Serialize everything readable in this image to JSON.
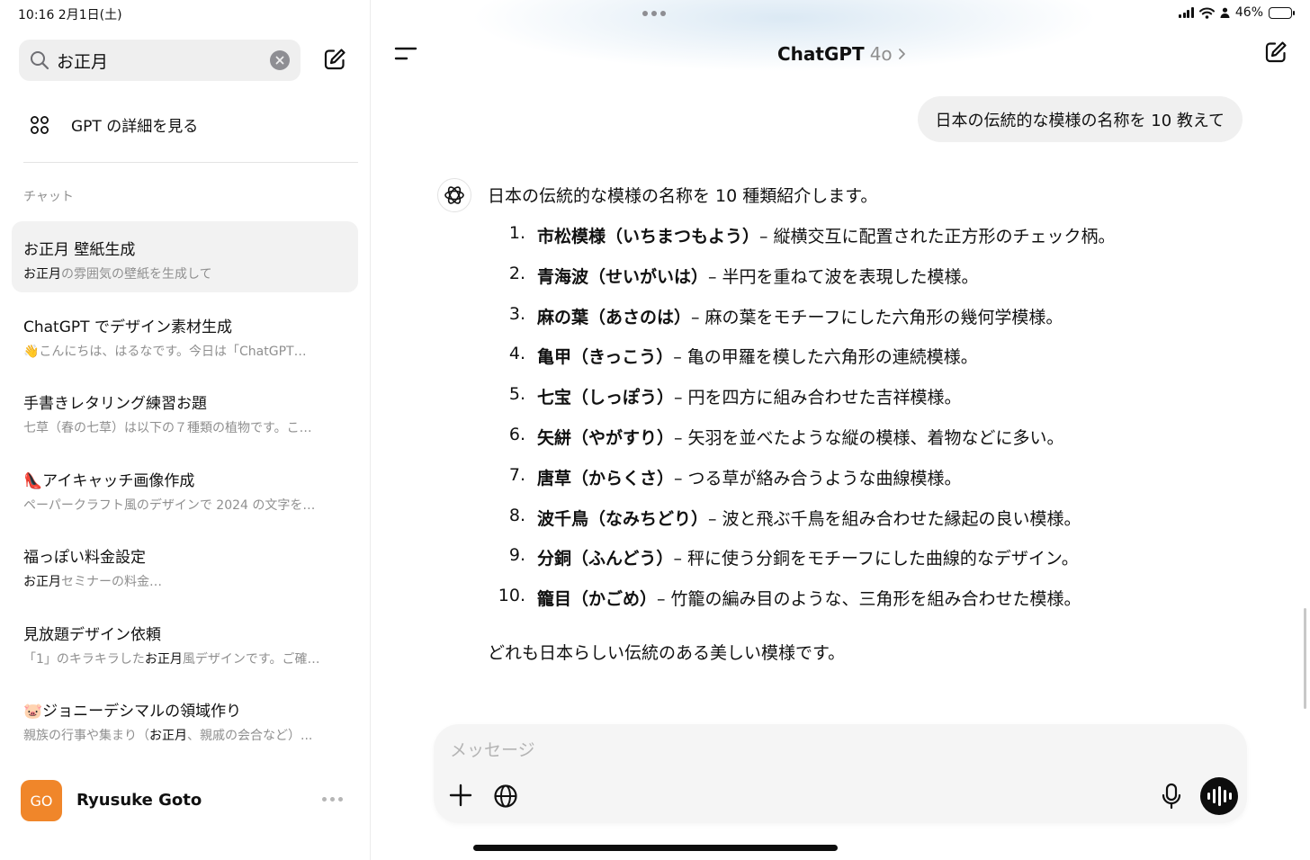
{
  "status_bar": {
    "time": "10:16  2月1日(土)",
    "battery": "46%",
    "battery_level": 0.46
  },
  "sidebar": {
    "search": {
      "value": "お正月"
    },
    "gpt_link_label": "GPT の詳細を見る",
    "section_label": "チャット",
    "chats": [
      {
        "title": "お正月 壁紙生成",
        "sub_hl": "お正月",
        "sub_rest": "の雰囲気の壁紙を生成して",
        "active": true
      },
      {
        "title": "ChatGPT でデザイン素材生成",
        "sub_hl": "",
        "sub_rest": "👋こんにちは、はるなです。今日は「ChatGPT…"
      },
      {
        "title": "手書きレタリング練習お題",
        "sub_hl": "",
        "sub_rest": "七草（春の七草）は以下の７種類の植物です。こ…"
      },
      {
        "title": "👠アイキャッチ画像作成",
        "sub_hl": "",
        "sub_rest": "ペーパークラフト風のデザインで 2024 の文字を…"
      },
      {
        "title": "福っぽい料金設定",
        "sub_hl": "お正月",
        "sub_rest": "セミナーの料金…"
      },
      {
        "title": "見放題デザイン依頼",
        "sub_pre": "「1」のキラキラした",
        "sub_hl": "お正月",
        "sub_rest": "風デザインです。ご確…"
      },
      {
        "title": "🐷ジョニーデシマルの領域作り",
        "sub_pre": "親族の行事や集まり（",
        "sub_hl": "お正月",
        "sub_rest": "、親戚の会合など）..."
      }
    ],
    "user": {
      "initials": "GO",
      "name": "Ryusuke Goto"
    }
  },
  "header": {
    "title": "ChatGPT",
    "model": "4o"
  },
  "conversation": {
    "user_message": "日本の伝統的な模様の名称を 10 教えて",
    "reply_intro": "日本の伝統的な模様の名称を 10 種類紹介します。",
    "reply_items": [
      {
        "num": "1.",
        "term": "市松模様（いちまつもよう）",
        "desc": " – 縦横交互に配置された正方形のチェック柄。"
      },
      {
        "num": "2.",
        "term": "青海波（せいがいは）",
        "desc": " – 半円を重ねて波を表現した模様。"
      },
      {
        "num": "3.",
        "term": "麻の葉（あさのは）",
        "desc": " – 麻の葉をモチーフにした六角形の幾何学模様。"
      },
      {
        "num": "4.",
        "term": "亀甲（きっこう）",
        "desc": " – 亀の甲羅を模した六角形の連続模様。"
      },
      {
        "num": "5.",
        "term": "七宝（しっぽう）",
        "desc": " – 円を四方に組み合わせた吉祥模様。"
      },
      {
        "num": "6.",
        "term": "矢絣（やがすり）",
        "desc": " – 矢羽を並べたような縦の模様、着物などに多い。"
      },
      {
        "num": "7.",
        "term": "唐草（からくさ）",
        "desc": " – つる草が絡み合うような曲線模様。"
      },
      {
        "num": "8.",
        "term": "波千鳥（なみちどり）",
        "desc": " – 波と飛ぶ千鳥を組み合わせた縁起の良い模様。"
      },
      {
        "num": "9.",
        "term": "分銅（ふんどう）",
        "desc": " – 秤に使う分銅をモチーフにした曲線的なデザイン。"
      },
      {
        "num": "10.",
        "term": "籠目（かごめ）",
        "desc": " – 竹籠の編み目のような、三角形を組み合わせた模様。"
      }
    ],
    "reply_outro": "どれも日本らしい伝統のある美しい模様です。"
  },
  "composer": {
    "placeholder": "メッセージ"
  },
  "colors": {
    "avatar_bg": "#f0862a",
    "bubble_bg": "#f0f0f0",
    "composer_bg": "#f5f5f5",
    "muted_text": "#8f8f8f"
  }
}
